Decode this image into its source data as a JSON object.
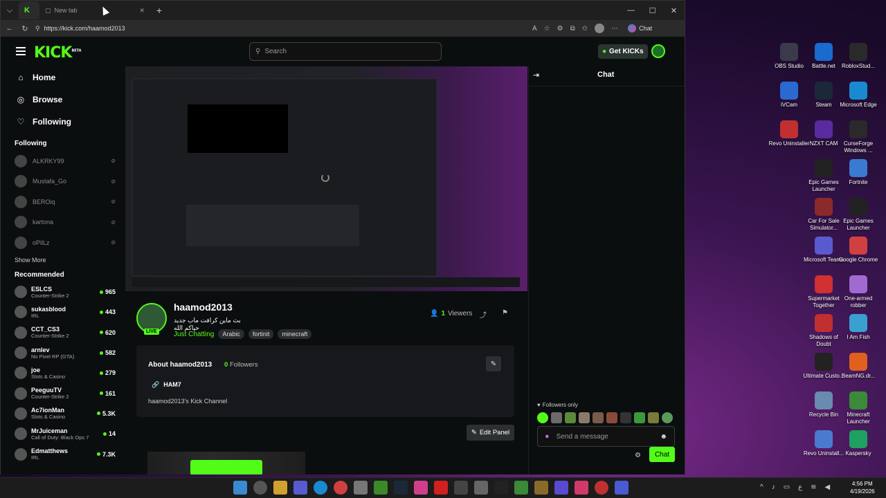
{
  "browser": {
    "tab_active_icon": "kick-favicon",
    "tab_new_label": "New tab",
    "url": "https://kick.com/haamod2013",
    "copilot_label": "Chat"
  },
  "kick": {
    "search_placeholder": "Search",
    "get_kicks_label": "Get KICKs",
    "logo_text": "KICK",
    "logo_beta": "BETA",
    "nav": [
      {
        "label": "Home",
        "icon": "home-icon"
      },
      {
        "label": "Browse",
        "icon": "browse-icon"
      },
      {
        "label": "Following",
        "icon": "heart-icon"
      }
    ],
    "following_title": "Following",
    "following": [
      {
        "name": "ALKRKY99"
      },
      {
        "name": "Mustafa_Go"
      },
      {
        "name": "BEROiq"
      },
      {
        "name": "kartona"
      },
      {
        "name": "oPilLz"
      }
    ],
    "show_more": "Show More",
    "recommended_title": "Recommended",
    "recommended": [
      {
        "name": "ESLCS",
        "category": "Counter-Strike 2",
        "viewers": "965"
      },
      {
        "name": "sukasblood",
        "category": "IRL",
        "viewers": "443"
      },
      {
        "name": "CCT_CS3",
        "category": "Counter-Strike 2",
        "viewers": "620"
      },
      {
        "name": "arnlev",
        "category": "No Pixel RP (GTA)",
        "viewers": "582"
      },
      {
        "name": "joe",
        "category": "Slots & Casino",
        "viewers": "279"
      },
      {
        "name": "PeeguuTV",
        "category": "Counter-Strike 2",
        "viewers": "161"
      },
      {
        "name": "Ac7ionMan",
        "category": "Slots & Casino",
        "viewers": "5.3K"
      },
      {
        "name": "MrJuiceman",
        "category": "Call of Duty: Black Ops 7",
        "viewers": "14"
      },
      {
        "name": "Edmatthews",
        "category": "IRL",
        "viewers": "7.3K"
      }
    ],
    "stream": {
      "streamer": "haamod2013",
      "title": "بث ماين كرافت ماب جديد حياكم الله",
      "live_badge": "LIVE",
      "category": "Just Chatting",
      "tags": [
        "Arabic",
        "fortinit",
        "minecraft"
      ],
      "viewer_count": "1",
      "viewer_label": "Viewers"
    },
    "about": {
      "title": "About haamod2013",
      "followers_count": "0",
      "followers_label": "Followers",
      "link_label": "HAM7",
      "description": "haamod2013's Kick Channel",
      "edit_panel_label": "Edit Panel"
    },
    "chat": {
      "title": "Chat",
      "followers_only": "Followers only",
      "input_placeholder": "Send a message",
      "send_label": "Chat"
    }
  },
  "desktop_icons": [
    {
      "label": "OBS Studio",
      "color": "#3a3a4a"
    },
    {
      "label": "Battle.net",
      "color": "#1a6ad0"
    },
    {
      "label": "RobloxStud...",
      "color": "#2a2a2a"
    },
    {
      "label": "iVCam",
      "color": "#2a6ad0"
    },
    {
      "label": "Steam",
      "color": "#1b2838"
    },
    {
      "label": "Microsoft Edge",
      "color": "#1a8ad0"
    },
    {
      "label": "Revo Uninstaller",
      "color": "#c03030"
    },
    {
      "label": "NZXT CAM",
      "color": "#5a2aa0"
    },
    {
      "label": "CurseForge Windows ...",
      "color": "#2a2a2a"
    },
    {
      "label": "Epic Games Launcher",
      "color": "#222"
    },
    {
      "label": "Fortnite",
      "color": "#3a7ad0"
    },
    {
      "label": "Car For Sale Simulator...",
      "color": "#8a2a2a"
    },
    {
      "label": "Epic Games Launcher",
      "color": "#222"
    },
    {
      "label": "Microsoft Teams",
      "color": "#5a5ad0"
    },
    {
      "label": "Google Chrome",
      "color": "#d04040"
    },
    {
      "label": "Supermarket Together",
      "color": "#d03030"
    },
    {
      "label": "One-armed robber",
      "color": "#a06ad0"
    },
    {
      "label": "Shadows of Doubt",
      "color": "#c03030"
    },
    {
      "label": "I Am Fish",
      "color": "#3aa0d0"
    },
    {
      "label": "Ultimate Custo...",
      "color": "#222"
    },
    {
      "label": "BeamNG.dr...",
      "color": "#e06020"
    },
    {
      "label": "Recycle Bin",
      "color": "#6a8ab0"
    },
    {
      "label": "Minecraft Launcher",
      "color": "#3a8a3a"
    },
    {
      "label": "Revo Uninstall...",
      "color": "#4a7ad0"
    },
    {
      "label": "Kaspersky",
      "color": "#20a060"
    }
  ],
  "clock": {
    "time": "4:56 PM",
    "date": "4/19/2026"
  }
}
